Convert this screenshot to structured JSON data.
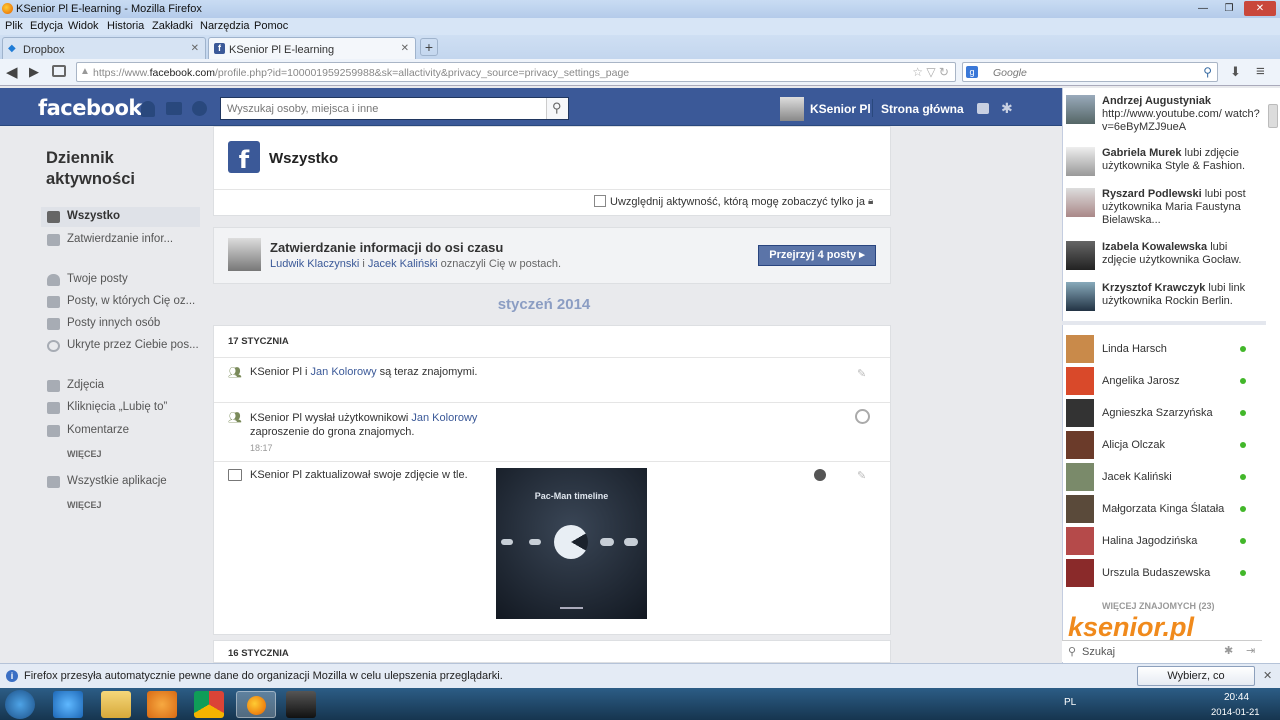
{
  "window": {
    "title": "KSenior Pl E-learning - Mozilla Firefox",
    "controls": [
      "—",
      "❐",
      "✕"
    ]
  },
  "menu": [
    "Plik",
    "Edycja",
    "Widok",
    "Historia",
    "Zakładki",
    "Narzędzia",
    "Pomoc"
  ],
  "tabs": [
    {
      "label": "Dropbox"
    },
    {
      "label": "KSenior Pl E-learning"
    }
  ],
  "tab_new": "+",
  "address": {
    "prefix": "https://www.",
    "domain": "facebook.com",
    "rest": "/profile.php?id=100001959259988&sk=allactivity&privacy_source=privacy_settings_page"
  },
  "websearch": {
    "placeholder": "Google",
    "engine": "g"
  },
  "fb": {
    "logo": "facebook",
    "search_placeholder": "Wyszukaj osoby, miejsca i inne",
    "user_name": "KSenior Pl",
    "home": "Strona główna"
  },
  "sidebar": {
    "heading": "Dziennik aktywności",
    "items": [
      {
        "label": "Wszystko",
        "selected": true
      },
      {
        "label": "Zatwierdzanie infor...",
        "badge": "4"
      },
      {
        "label": "Twoje posty"
      },
      {
        "label": "Posty, w których Cię oz..."
      },
      {
        "label": "Posty innych osób"
      },
      {
        "label": "Ukryte przez Ciebie pos..."
      },
      {
        "label": "Zdjęcia"
      },
      {
        "label": "Kliknięcia „Lubię to”"
      },
      {
        "label": "Komentarze"
      },
      {
        "label": "Wszystkie aplikacje"
      }
    ],
    "more1": "WIĘCEJ",
    "more2": "WIĘCEJ"
  },
  "header": {
    "title": "Wszystko",
    "checkbox_label": "Uwzględnij aktywność, którą mogę zobaczyć tylko ja"
  },
  "review": {
    "title": "Zatwierdzanie informacji do osi czasu",
    "person1": "Ludwik Klaczynski",
    "and": "i",
    "person2": "Jacek Kaliński",
    "rest": "oznaczyli Cię w postach.",
    "button": "Przejrzyj 4 posty ▸"
  },
  "month": "styczeń 2014",
  "days": [
    {
      "date": "17 STYCZNIA"
    },
    {
      "date": "16 STYCZNIA"
    }
  ],
  "activities": [
    {
      "pre": "KSenior Pl i ",
      "link": "Jan Kolorowy",
      "post": " są teraz znajomymi."
    },
    {
      "pre": "KSenior Pl wysłał użytkownikowi ",
      "link": "Jan Kolorowy",
      "post2": "zaproszenie do grona znajomych.",
      "time": "18:17"
    },
    {
      "pre": "KSenior Pl zaktualizował swoje zdjęcie w tle.",
      "image_title": "Pac-Man timeline"
    }
  ],
  "ticker": [
    {
      "name": "Andrzej Augustyniak",
      "text": "http://www.youtube.com/ watch?v=6eByMZJ9ueA"
    },
    {
      "name": "Gabriela Murek",
      "text": "lubi zdjęcie użytkownika Style & Fashion."
    },
    {
      "name": "Ryszard Podlewski",
      "text": "lubi post użytkownika Maria Faustyna Bielawska..."
    },
    {
      "name": "Izabela Kowalewska",
      "text": "lubi zdjęcie użytkownika Gocław."
    },
    {
      "name": "Krzysztof Krawczyk",
      "text": "lubi link użytkownika Rockin Berlin."
    }
  ],
  "chat": [
    {
      "name": "Linda Harsch",
      "color": "#c98a4a"
    },
    {
      "name": "Angelika Jarosz",
      "color": "#d9492a"
    },
    {
      "name": "Agnieszka Szarzyńska",
      "color": "#333333"
    },
    {
      "name": "Alicja Olczak",
      "color": "#6b3b2a"
    },
    {
      "name": "Jacek Kaliński",
      "color": "#7a8a6a"
    },
    {
      "name": "Małgorzata Kinga Ślatała",
      "color": "#5a4a3a"
    },
    {
      "name": "Halina Jagodzińska",
      "color": "#b54a4a"
    },
    {
      "name": "Urszula Budaszewska",
      "color": "#8a2a2a"
    }
  ],
  "chat_more": "WIĘCEJ ZNAJOMYCH (23)",
  "chat_search": "Szukaj",
  "watermark": "ksenior.pl",
  "notification": {
    "text": "Firefox przesyła automatycznie pewne dane do organizacji Mozilla w celu ulepszenia przeglądarki.",
    "button": "Wybierz, co udostępniać"
  },
  "tray": {
    "lang": "PL",
    "time": "20:44",
    "date": "2014-01-21"
  },
  "colors": {
    "fb_blue": "#3b5998",
    "link": "#3b5998",
    "online": "#42b72a"
  }
}
